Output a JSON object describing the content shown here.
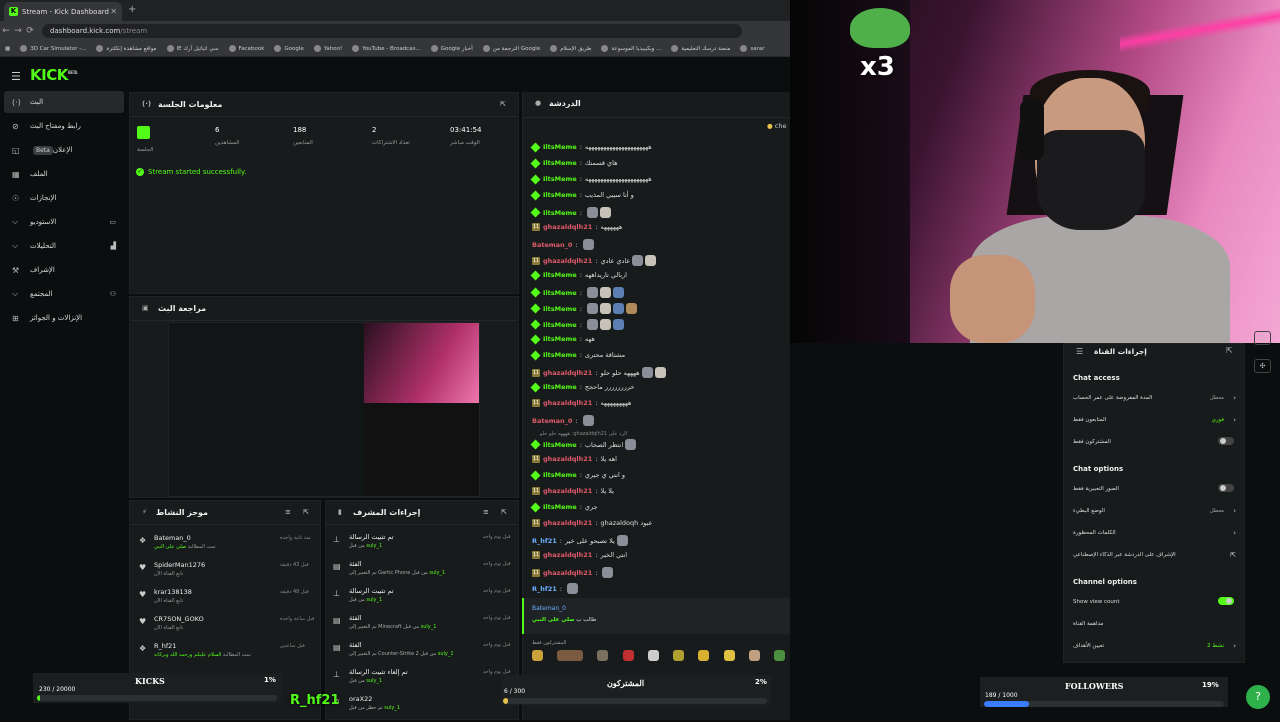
{
  "browser": {
    "tab_title": "Stream - Kick Dashboard",
    "url_host": "dashboard.kick.com",
    "url_path": "/stream",
    "bookmarks": [
      "3D Car Simulator -...",
      "مواقع مشاهدة إنكلترة",
      "IE سي اتياتيل آرك",
      "Facebook",
      "Google",
      "Yahoo!",
      "YouTube - Broadcas...",
      "Google أخبار",
      "الترجمة من Google",
      "طريق الإسلام",
      "ويكيبيديا الموسوعة ...",
      "منصة درسك التعليمية",
      "sarar"
    ]
  },
  "brand": {
    "logo": "KICK",
    "logo_sup": "BETA",
    "accent": "#53fc18"
  },
  "sidebar": {
    "items": [
      {
        "label": "البث",
        "icon": "broadcast-icon"
      },
      {
        "label": "رابط ومفتاح البث",
        "icon": "link-icon"
      },
      {
        "label": "الإعلان",
        "badge": "Beta",
        "icon": "megaphone-icon"
      },
      {
        "label": "الملف",
        "icon": "file-icon"
      },
      {
        "label": "الإنجازات",
        "icon": "trophy-icon"
      },
      {
        "label": "الاستوديو",
        "icon": "studio-icon"
      },
      {
        "label": "التحليلات",
        "icon": "chart-icon"
      },
      {
        "label": "الإشراف",
        "icon": "hammer-icon"
      },
      {
        "label": "المجتمع",
        "icon": "people-icon"
      },
      {
        "label": "الإنزالات و الجوائز",
        "icon": "gift-icon"
      }
    ]
  },
  "session": {
    "title": "معلومات الجلسة",
    "stats": [
      {
        "value": "",
        "label": "الجلسة"
      },
      {
        "value": "6",
        "label": "المشاهدين"
      },
      {
        "value": "188",
        "label": "المتابعين"
      },
      {
        "value": "2",
        "label": "تعداد الاشتراكات"
      },
      {
        "value": "03:41:54",
        "label": "الوقت مباشر"
      }
    ],
    "success": "Stream started successfully."
  },
  "preview": {
    "title": "مراجعة البث"
  },
  "activity": {
    "title": "موجز النشاط",
    "rows": [
      {
        "name": "Bateman_0",
        "sub": "تمت المطالبة",
        "sub_hl": "صلي على النبي",
        "time": "منذ ثانية واحدة",
        "icon": "reward-icon"
      },
      {
        "name": "SpiderMan1276",
        "sub": "تابع القناة الآن",
        "sub_hl": "",
        "time": "قبل 43 دقيقة",
        "icon": "heart-icon"
      },
      {
        "name": "krar138138",
        "sub": "تابع القناة الآن",
        "sub_hl": "",
        "time": "قبل 48 دقيقة",
        "icon": "heart-icon"
      },
      {
        "name": "CR7SON_GOKO",
        "sub": "تابع القناة الآن",
        "sub_hl": "",
        "time": "قبل ساعة واحدة",
        "icon": "heart-icon"
      },
      {
        "name": "R_hf21",
        "sub": "تمت المطالبة",
        "sub_hl": "السلام عليكم ورحمه الله وبركاته",
        "time": "قبل ساعتين",
        "icon": "reward-icon"
      }
    ]
  },
  "modactions": {
    "title": "إجراءات المشرف",
    "rows": [
      {
        "name": "تم تثبيت الرسالة",
        "sub": "من قبل",
        "sub_hl": "suly_1",
        "time": "قبل يوم واحد",
        "icon": "pin-icon"
      },
      {
        "name": "الفئة",
        "sub": "تم التغيير إلى Gartic Phone من قبل",
        "sub_hl": "suly_1",
        "time": "قبل يوم واحد",
        "icon": "category-icon"
      },
      {
        "name": "تم تثبيت الرسالة",
        "sub": "من قبل",
        "sub_hl": "suly_1",
        "time": "قبل يوم واحد",
        "icon": "pin-icon"
      },
      {
        "name": "الفئة",
        "sub": "تم التغيير إلى Minecraft من قبل",
        "sub_hl": "suly_1",
        "time": "قبل يوم واحد",
        "icon": "category-icon"
      },
      {
        "name": "الفئة",
        "sub": "تم التغيير إلى Counter-Strike 2 من قبل",
        "sub_hl": "suly_1",
        "time": "قبل يوم واحد",
        "icon": "category-icon"
      },
      {
        "name": "تم إلغاء تثبيت الرسالة",
        "sub": "من قبل",
        "sub_hl": "suly_1",
        "time": "قبل يوم واحد",
        "icon": "unpin-icon"
      },
      {
        "name": "oraX22",
        "sub": "تم حظر من قبل",
        "sub_hl": "suly_1",
        "time": "",
        "icon": "ban-icon"
      }
    ]
  },
  "chat": {
    "title": "الدردشة",
    "pinned_user": "che",
    "lines": [
      {
        "user": "IltsMeme",
        "text": "هههههههههههههههههههههه",
        "color": "g",
        "type": "dm"
      },
      {
        "user": "IltsMeme",
        "text": "هاي قسمتك",
        "color": "g",
        "type": "dm"
      },
      {
        "user": "IltsMeme",
        "text": "هههههههههههههههههههههه",
        "color": "g",
        "type": "dm"
      },
      {
        "user": "IltsMeme",
        "text": "و أنا سيبي المذيب",
        "color": "g",
        "type": "dm"
      },
      {
        "user": "IltsMeme",
        "text": "",
        "color": "g",
        "type": "dm",
        "emotes": 2
      },
      {
        "user": "ghazaldqlh21",
        "text": "ههههههه",
        "color": "r",
        "type": "bd"
      },
      {
        "user": "Bateman_0",
        "text": "",
        "color": "r",
        "type": "none",
        "emotes": 1
      },
      {
        "user": "ghazaldqlh21",
        "text": "عادي عادي",
        "color": "r",
        "type": "bd",
        "emotes": 2
      },
      {
        "user": "IltsMeme",
        "text": "اربالي تاريداههه",
        "color": "g",
        "type": "dm"
      },
      {
        "user": "IltsMeme",
        "text": "",
        "color": "g",
        "type": "dm",
        "emotes": 3
      },
      {
        "user": "IltsMeme",
        "text": "",
        "color": "g",
        "type": "dm",
        "emotes": 4
      },
      {
        "user": "IltsMeme",
        "text": "",
        "color": "g",
        "type": "dm",
        "emotes": 3
      },
      {
        "user": "IltsMeme",
        "text": "ههه",
        "color": "g",
        "type": "dm"
      },
      {
        "user": "IltsMeme",
        "text": "مشتاقة محترى",
        "color": "g",
        "type": "dm"
      },
      {
        "user": "ghazaldqlh21",
        "text": "ههههه حلو حلو",
        "color": "r",
        "type": "bd",
        "emotes": 2
      },
      {
        "user": "IltsMeme",
        "text": "خرررررررر ماحجج",
        "color": "g",
        "type": "dm"
      },
      {
        "user": "ghazaldqlh21",
        "text": "هههههههههه",
        "color": "r",
        "type": "bd"
      },
      {
        "user": "Bateman_0",
        "text": "",
        "color": "r",
        "type": "none",
        "emotes": 1
      },
      {
        "user": "IltsMeme",
        "text": "انتظر الصحاب",
        "color": "g",
        "type": "dm",
        "emotes": 1
      },
      {
        "user": "ghazaldqlh21",
        "text": "اهه يلا",
        "color": "r",
        "type": "bd"
      },
      {
        "user": "IltsMeme",
        "text": "و انتي ي جيري",
        "color": "g",
        "type": "dm"
      },
      {
        "user": "ghazaldqlh21",
        "text": "يلا يلا",
        "color": "r",
        "type": "bd"
      },
      {
        "user": "IltsMeme",
        "text": "جري",
        "color": "g",
        "type": "dm"
      },
      {
        "user": "ghazaldqlh21",
        "text": "ghazaldoqh عبود",
        "color": "r",
        "type": "bd"
      },
      {
        "user": "R_hf21",
        "text": "يلا تصبحو على خير",
        "color": "b",
        "type": "none",
        "emotes": 1
      },
      {
        "user": "ghazaldqlh21",
        "text": "انتي الخير",
        "color": "r",
        "type": "bd"
      },
      {
        "user": "ghazaldqlh21",
        "text": "",
        "color": "r",
        "type": "bd",
        "emotes": 1
      },
      {
        "user": "R_hf21",
        "text": "",
        "color": "b",
        "type": "none",
        "emotes": 1
      }
    ],
    "reply_preview": "ههههه حلو حلو :ghazaldqlh21 الرد على",
    "reward_user": "Bateman_0",
    "reward_text": "طالب ب",
    "reward_hl": "صلي على النبي",
    "subs_only": "المشتركون فقط"
  },
  "settings": {
    "title": "إجراءات القناة",
    "sections": [
      {
        "heading": "Chat access",
        "rows": [
          {
            "label": "المدة المفروضة على عمر الحساب",
            "value": "معطل",
            "control": "chevron"
          },
          {
            "label": "المتابعون فقط",
            "value": "فوري",
            "value_green": true,
            "control": "chevron"
          },
          {
            "label": "المشتركون فقط",
            "value": "",
            "control": "toggle-off"
          }
        ]
      },
      {
        "heading": "Chat options",
        "rows": [
          {
            "label": "الصور التعبيرية فقط",
            "value": "",
            "control": "toggle-off"
          },
          {
            "label": "الوضع البطيء",
            "value": "معطل",
            "control": "chevron"
          },
          {
            "label": "الكلمات المحظورة",
            "value": "",
            "control": "chevron"
          },
          {
            "label": "الإشراف على الدردشة عبر الذكاء الإصطناعي",
            "value": "",
            "control": "external"
          }
        ]
      },
      {
        "heading": "Channel options",
        "rows": [
          {
            "label": "Show view count",
            "value": "",
            "control": "toggle-on"
          },
          {
            "label": "مداهمة القناة",
            "value": "",
            "control": "none"
          },
          {
            "label": "تعيين الأهداف",
            "value": "نشط 2",
            "value_green": true,
            "control": "chevron"
          }
        ]
      }
    ]
  },
  "overlay": {
    "webcam_emote_text": "x3",
    "username": "R_hf21",
    "goals": [
      {
        "name": "KICKS",
        "current": "230 / 20000",
        "percent": "1%",
        "progress": 0.0115,
        "color": "#53fc18"
      },
      {
        "name": "المشتركون",
        "current": "6 / 300",
        "percent": "2%",
        "progress": 0.02,
        "color": "#e8c14a"
      },
      {
        "name": "FOLLOWERS",
        "current": "189 / 1000",
        "percent": "19%",
        "progress": 0.189,
        "color": "#3a7bff"
      }
    ]
  }
}
